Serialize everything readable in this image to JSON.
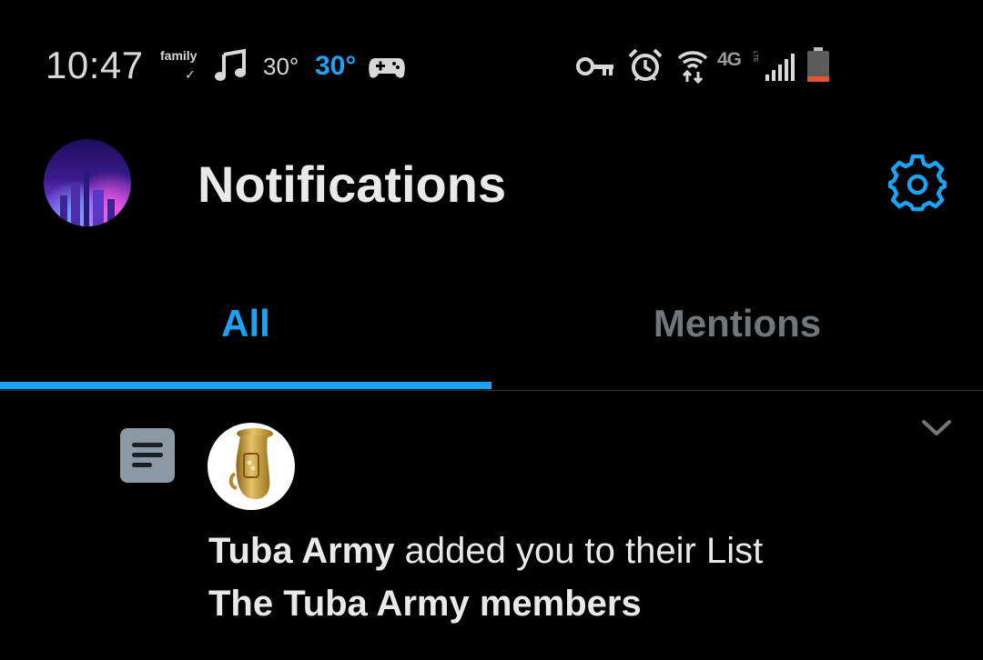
{
  "status_bar": {
    "time": "10:47",
    "family_label": "family",
    "family_check": "✓",
    "temp_1": "30°",
    "temp_2": "30°",
    "network_label": "4G",
    "network_sub": "LTE",
    "icons": [
      "music-note-icon",
      "gamepad-icon",
      "vpn-key-icon",
      "alarm-icon",
      "wifi-icon",
      "signal-icon",
      "battery-icon"
    ]
  },
  "header": {
    "title": "Notifications",
    "settings_icon": "gear-icon"
  },
  "tabs": [
    {
      "label": "All",
      "active": true
    },
    {
      "label": "Mentions",
      "active": false
    }
  ],
  "notification": {
    "type_icon": "list-icon",
    "user_name": "Tuba Army",
    "action_text": " added you to their List",
    "list_name": "The Tuba Army members"
  },
  "colors": {
    "accent": "#1da1f2",
    "background": "#000000",
    "text_primary": "#e7e9ea",
    "text_secondary": "#71767b"
  }
}
